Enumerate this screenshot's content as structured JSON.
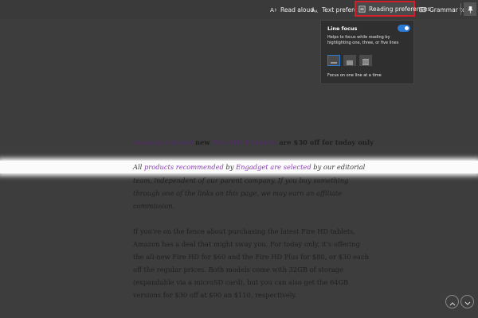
{
  "toolbar": {
    "read_aloud": "Read aloud",
    "text_preferences": "Text preferences",
    "reading_preferences": "Reading preferences",
    "grammar_tools": "Grammar tools"
  },
  "line_focus": {
    "title": "Line focus",
    "enabled": true,
    "description": "Helps to focus while reading by highlighting one, three, or five lines",
    "hint": "Focus on one line at a time",
    "options": [
      "one-line",
      "three-lines",
      "five-lines"
    ],
    "selected": "one-line"
  },
  "article": {
    "headline": {
      "p1": "Amazon's brand",
      "p2": " new ",
      "p3": "Fire HD 8 tablets",
      "p4": " are $30 off for today only"
    },
    "focus_line": {
      "p1": "All ",
      "p2": "products",
      "p3": " ",
      "p4": "recommended",
      "p5": " by ",
      "p6": "Engadget",
      "p7": " ",
      "p8": "are selected",
      "p9": " by our editorial"
    },
    "disclaimer_lines": [
      "team, independent of our parent company. If you buy something",
      "through one of the links on this page, we may earn an affiliate",
      "commission."
    ],
    "body_lines": [
      "If you're on the fence about purchasing the latest Fire HD tablets,",
      "Amazon has a deal that might sway you. For today only, it's offering",
      "the all-new Fire HD for $60 and the Fire HD Plus for $80, or $30 each",
      "off the regular prices. Both models come with 32GB of storage",
      "(expandable via a microSD card), but you can also get the 64GB",
      "versions for $30 off at $90 an $110, respectively."
    ]
  },
  "colors": {
    "accent_blue": "#2a7ad6",
    "highlight_border": "#d21f2a",
    "link_purple": "#8a3fb5"
  }
}
